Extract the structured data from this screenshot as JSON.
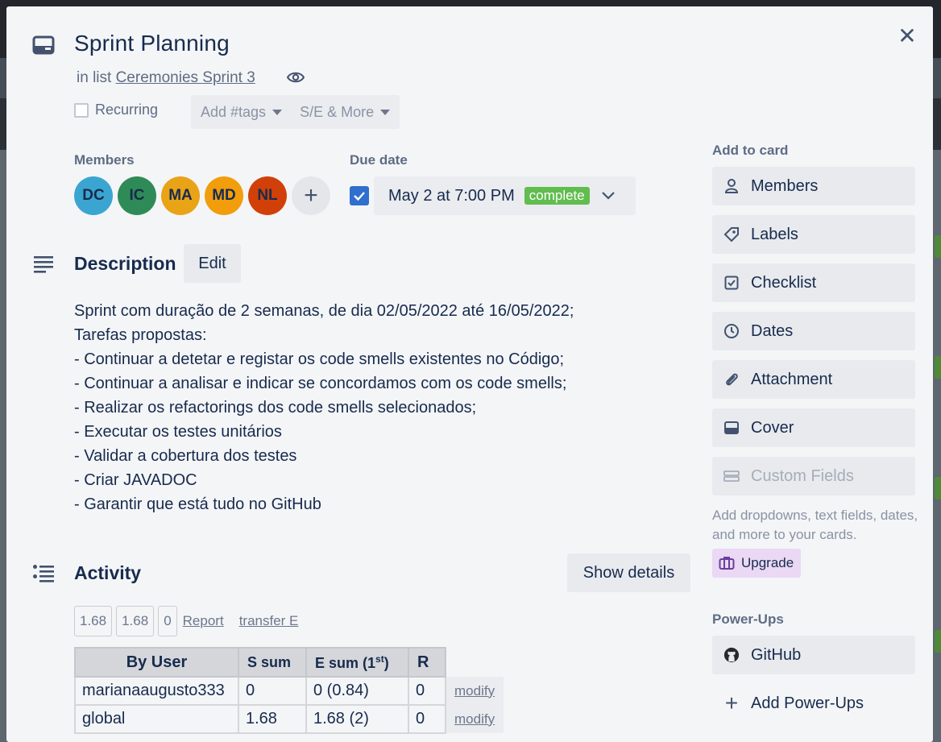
{
  "card": {
    "title": "Sprint Planning",
    "in_list_prefix": "in list",
    "list_name": "Ceremonies Sprint 3",
    "recurring_label": "Recurring",
    "tags_label": "Add #tags",
    "se_more_label": "S/E & More"
  },
  "members": {
    "label": "Members",
    "avatars": [
      {
        "initials": "DC",
        "color": "#3ba5d1"
      },
      {
        "initials": "IC",
        "color": "#2e8b57"
      },
      {
        "initials": "MA",
        "color": "#e8a317"
      },
      {
        "initials": "MD",
        "color": "#f29d0c"
      },
      {
        "initials": "NL",
        "color": "#d14009"
      }
    ],
    "add_symbol": "+"
  },
  "due": {
    "label": "Due date",
    "value": "May 2 at 7:00 PM",
    "status": "complete",
    "checked": true
  },
  "description": {
    "title": "Description",
    "edit_label": "Edit",
    "lines": [
      "Sprint com duração de 2 semanas, de dia 02/05/2022 até 16/05/2022;",
      "Tarefas propostas:",
      "- Continuar a detetar e registar os code smells existentes no Código;",
      "- Continuar a analisar e indicar se concordamos com os code smells;",
      "- Realizar os refactorings dos code smells selecionados;",
      "- Executar os testes unitários",
      "- Validar a cobertura dos testes",
      "- Criar JAVADOC",
      "- Garantir que está tudo no GitHub"
    ]
  },
  "activity": {
    "title": "Activity",
    "show_details_label": "Show details",
    "stats": [
      "1.68",
      "1.68",
      "0"
    ],
    "report_label": "Report",
    "transfer_label": "transfer E",
    "table": {
      "headers": {
        "by_user": "By User",
        "s_sum": "S sum",
        "e_sum": "E sum (1",
        "e_sup": "st",
        "e_close": ")",
        "r": "R"
      },
      "rows": [
        {
          "user": "marianaaugusto333",
          "s": "0",
          "e": "0 (0.84)",
          "r": "0",
          "action": "modify"
        },
        {
          "user": "global",
          "s": "1.68",
          "e": "1.68 (2)",
          "r": "0",
          "action": "modify"
        }
      ]
    }
  },
  "sidebar": {
    "add_to_card_label": "Add to card",
    "buttons": [
      {
        "label": "Members",
        "icon": "person-icon"
      },
      {
        "label": "Labels",
        "icon": "tag-icon"
      },
      {
        "label": "Checklist",
        "icon": "checklist-icon"
      },
      {
        "label": "Dates",
        "icon": "clock-icon"
      },
      {
        "label": "Attachment",
        "icon": "paperclip-icon"
      },
      {
        "label": "Cover",
        "icon": "cover-icon"
      },
      {
        "label": "Custom Fields",
        "icon": "custom-fields-icon"
      }
    ],
    "custom_fields_note": "Add dropdowns, text fields, dates, and more to your cards.",
    "upgrade_label": "Upgrade",
    "powerups_label": "Power-Ups",
    "github_label": "GitHub",
    "add_powerups_label": "Add Power-Ups"
  }
}
